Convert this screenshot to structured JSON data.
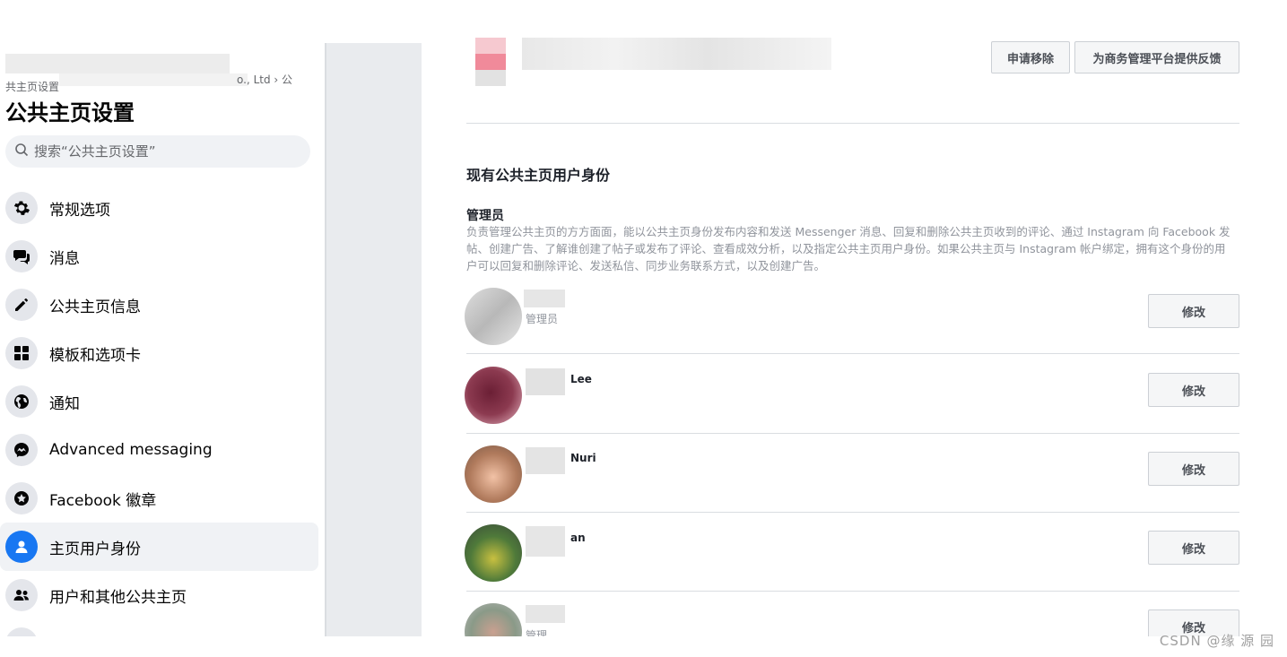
{
  "sidebar": {
    "breadcrumb_tail": "o., Ltd › 公",
    "breadcrumb_line2": "共主页设置",
    "title": "公共主页设置",
    "search_placeholder": "搜索“公共主页设置”",
    "items": [
      {
        "label": "常规选项",
        "icon": "gear-icon"
      },
      {
        "label": "消息",
        "icon": "chat-bubbles-icon"
      },
      {
        "label": "公共主页信息",
        "icon": "pencil-icon"
      },
      {
        "label": "模板和选项卡",
        "icon": "grid-icon"
      },
      {
        "label": "通知",
        "icon": "globe-icon"
      },
      {
        "label": "Advanced messaging",
        "icon": "messenger-icon"
      },
      {
        "label": "Facebook 徽章",
        "icon": "star-badge-icon"
      },
      {
        "label": "主页用户身份",
        "icon": "person-icon",
        "active": true
      },
      {
        "label": "用户和其他公共主页",
        "icon": "people-icon"
      }
    ]
  },
  "main": {
    "request_removal_label": "申请移除",
    "feedback_label": "为商务管理平台提供反馈",
    "section_title": "现有公共主页用户身份",
    "role_title": "管理员",
    "role_description": "负责管理公共主页的方方面面，能以公共主页身份发布内容和发送 Messenger 消息、回复和删除公共主页收到的评论、通过 Instagram 向 Facebook 发帖、创建广告、了解谁创建了帖子或发布了评论、查看成效分析，以及指定公共主页用户身份。如果公共主页与 Instagram 帐户绑定，拥有这个身份的用户可以回复和删除评论、发送私信、同步业务联系方式，以及创建广告。",
    "people": [
      {
        "name": "",
        "role": "管理员",
        "edit_label": "修改"
      },
      {
        "name": "Lee",
        "role": "",
        "edit_label": "修改"
      },
      {
        "name": "Nuri",
        "role": "",
        "edit_label": "修改"
      },
      {
        "name": "an",
        "role": "",
        "edit_label": "修改"
      },
      {
        "name": "",
        "role": "管理",
        "edit_label": "修改"
      }
    ]
  },
  "watermark": "CSDN @缘 源 园",
  "colors": {
    "accent": "#1877f2",
    "gutter": "#e9ebee"
  }
}
